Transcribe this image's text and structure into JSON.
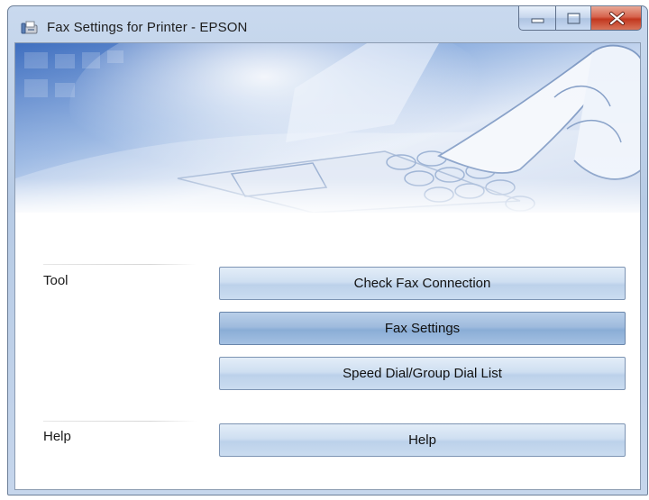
{
  "window": {
    "title": "Fax Settings for Printer - EPSON",
    "icon": "fax-app-icon",
    "controls": {
      "minimize": "minimize-icon",
      "maximize": "maximize-icon",
      "close": "close-icon"
    }
  },
  "sections": {
    "tool_label": "Tool",
    "help_label": "Help"
  },
  "buttons": {
    "check_fax_connection": "Check Fax Connection",
    "fax_settings": "Fax Settings",
    "speed_dial": "Speed Dial/Group Dial List",
    "help": "Help"
  },
  "colors": {
    "close_button": "#c2371f",
    "active_button": "#9fbbdd",
    "button": "#cfdff1"
  }
}
